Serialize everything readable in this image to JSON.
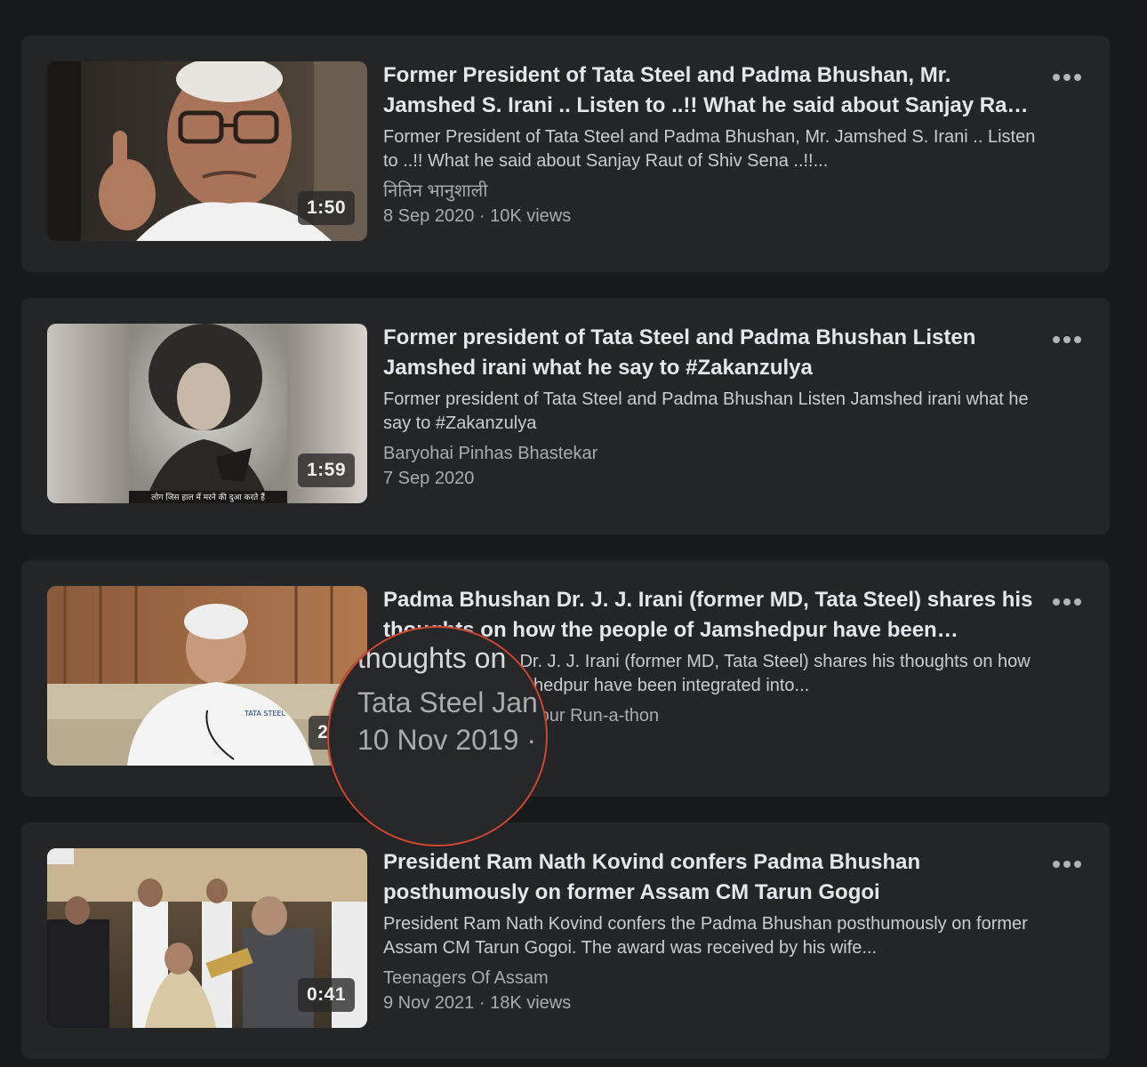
{
  "videos": [
    {
      "duration": "1:50",
      "title": "Former President of Tata Steel and Padma Bhushan, Mr. Jamshed S. Irani .. Listen to ..!! What he said about Sanjay Raut of Shiv Sena ..!!",
      "description": "Former President of Tata Steel and Padma Bhushan, Mr. Jamshed S. Irani .. Listen to ..!! What he said about Sanjay Raut of Shiv Sena ..!!...",
      "channel": "नितिन भानुशाली",
      "meta": "8 Sep 2020 · 10K views"
    },
    {
      "duration": "1:59",
      "title": "Former president of Tata Steel and Padma Bhushan Listen Jamshed irani what he say to #Zakanzulya",
      "description": "Former president of Tata Steel and Padma Bhushan Listen Jamshed irani what he say to #Zakanzulya",
      "channel": "Baryohai Pinhas Bhastekar",
      "meta": "7 Sep 2020",
      "thumb_caption": "लोग जिस हाल में मरने की दुआ करते हैं"
    },
    {
      "duration": "2:3",
      "title": "Padma Bhushan Dr. J. J. Irani (former MD, Tata Steel) shares his thoughts on how the people of Jamshedpur have been integrated into...",
      "description": "Padma Bhushan Dr. J. J. Irani (former MD, Tata Steel) shares his thoughts on how the people of Jamshedpur have been integrated into...",
      "channel": "Tata Steel Jamshedpur Run-a-thon",
      "meta": "10 Nov 2019 · views",
      "shirt_text": "TATA STEEL"
    },
    {
      "duration": "0:41",
      "title": "President Ram Nath Kovind confers Padma Bhushan posthumously on former Assam CM Tarun Gogoi",
      "description": "President Ram Nath Kovind confers the Padma Bhushan posthumously on former Assam CM Tarun Gogoi. The award was received by his wife...",
      "channel": "Teenagers Of Assam",
      "meta": "9 Nov 2021 · 18K views"
    }
  ],
  "magnifier": {
    "line1": "thoughts on",
    "line2": "Tata Steel Jan",
    "line3": "10 Nov 2019 ·"
  },
  "colors": {
    "background": "#18191a",
    "card": "#242526",
    "magnifier_ring": "#d2462f"
  }
}
